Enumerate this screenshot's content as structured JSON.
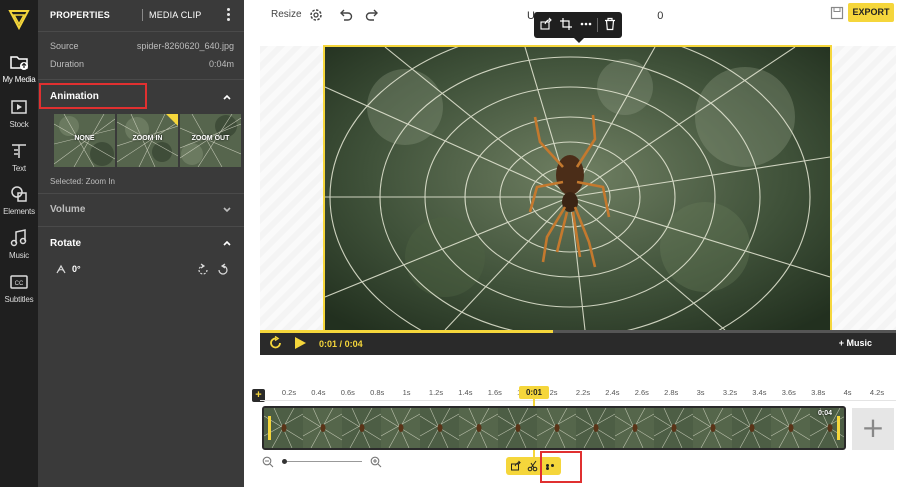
{
  "rail": {
    "items": [
      {
        "label": "My Media",
        "icon": "folder-upload-icon"
      },
      {
        "label": "Stock",
        "icon": "film-stock-icon"
      },
      {
        "label": "Text",
        "icon": "text-icon"
      },
      {
        "label": "Elements",
        "icon": "shapes-icon"
      },
      {
        "label": "Music",
        "icon": "music-note-icon"
      },
      {
        "label": "Subtitles",
        "icon": "cc-icon"
      }
    ]
  },
  "panel": {
    "tabs": {
      "properties": "PROPERTIES",
      "media_clip": "MEDIA CLIP"
    },
    "source_label": "Source",
    "source_value": "spider-8260620_640.jpg",
    "duration_label": "Duration",
    "duration_value": "0:04m",
    "animation": {
      "title": "Animation",
      "options": [
        "NONE",
        "ZOOM IN",
        "ZOOM OUT"
      ],
      "selected_index": 1,
      "selected_text": "Selected: Zoom In"
    },
    "volume_title": "Volume",
    "rotate": {
      "title": "Rotate",
      "value": "0°"
    }
  },
  "topbar": {
    "resize_label": "Resize",
    "title": "U                                        0",
    "export_label": "EXPORT"
  },
  "player": {
    "current_time": "0:01",
    "separator": "/",
    "total_time": "0:04",
    "progress_fraction": 0.46,
    "music_label": "+ Music"
  },
  "timeline": {
    "ticks": [
      "0.2s",
      "0.4s",
      "0.6s",
      "0.8s",
      "1s",
      "1.2s",
      "1.4s",
      "1.6s",
      "1.8s",
      "2s",
      "2.2s",
      "2.4s",
      "2.6s",
      "2.8s",
      "3s",
      "3.2s",
      "3.4s",
      "3.6s",
      "3.8s",
      "4s",
      "4.2s"
    ],
    "playhead_label": "0:01",
    "clip_duration": "0:04",
    "add_track_label": "+",
    "add_clip_label": "+"
  },
  "colors": {
    "accent": "#f5d63b",
    "panel_bg": "#3a3a3a",
    "rail_bg": "#1f1f1f",
    "highlight": "#e03030"
  }
}
